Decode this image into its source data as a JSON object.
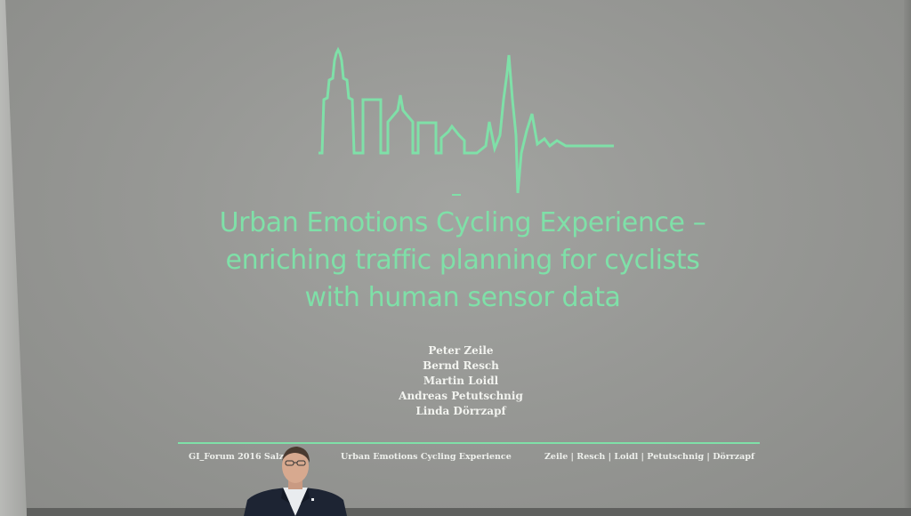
{
  "slide": {
    "title_lines": [
      "Urban Emotions Cycling Experience –",
      "enriching traffic planning for cyclists",
      "with human sensor data"
    ],
    "authors": [
      "Peter Zeile",
      "Bernd Resch",
      "Martin Loidl",
      "Andreas Petutschnig",
      "Linda Dörrzapf"
    ],
    "footer": {
      "left": "GI_Forum 2016 Salz",
      "center": "Urban Emotions Cycling Experience",
      "right": "Zeile | Resch | Loidl | Petutschnig | Dörrzapf"
    },
    "accent_color": "#7fe0a8"
  },
  "icons": {
    "logo": "city-skyline-heartbeat-icon",
    "person": "presenter-figure"
  }
}
